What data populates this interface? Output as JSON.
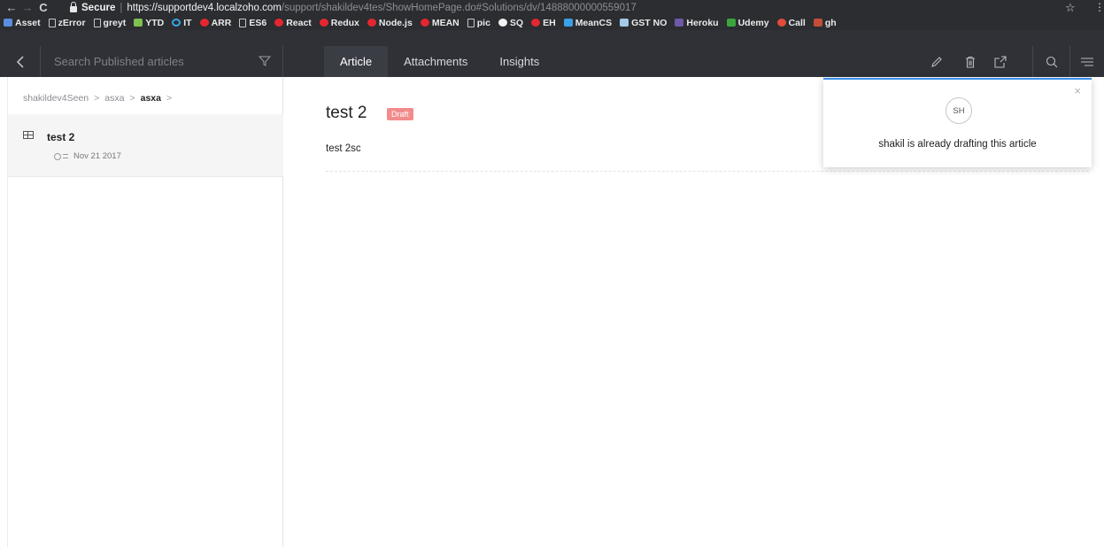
{
  "browser": {
    "back_glyph": "←",
    "forward_glyph": "→",
    "reload_glyph": "C",
    "secure_label": "Secure",
    "url_host": "https://supportdev4.localzoho.com",
    "url_path": "/support/shakildev4tes/ShowHomePage.do#Solutions/dv/14888000000559017",
    "star_glyph": "☆",
    "menu_glyph": "⋮",
    "bookmarks": [
      {
        "label": "Asset",
        "icon": "asset-icon"
      },
      {
        "label": "zError",
        "icon": "doc-icon"
      },
      {
        "label": "greyt",
        "icon": "doc-icon"
      },
      {
        "label": "YTD",
        "icon": "green-icon"
      },
      {
        "label": "IT",
        "icon": "ie-icon"
      },
      {
        "label": "ARR",
        "icon": "youtube-icon"
      },
      {
        "label": "ES6",
        "icon": "doc-icon"
      },
      {
        "label": "React",
        "icon": "youtube-icon"
      },
      {
        "label": "Redux",
        "icon": "youtube-icon"
      },
      {
        "label": "Node.js",
        "icon": "youtube-icon"
      },
      {
        "label": "MEAN",
        "icon": "youtube-icon"
      },
      {
        "label": "pic",
        "icon": "doc-icon"
      },
      {
        "label": "SQ",
        "icon": "github-icon"
      },
      {
        "label": "EH",
        "icon": "youtube-icon"
      },
      {
        "label": "MeanCS",
        "icon": "blue-icon"
      },
      {
        "label": "GST NO",
        "icon": "gst-icon"
      },
      {
        "label": "Heroku",
        "icon": "heroku-icon"
      },
      {
        "label": "Udemy",
        "icon": "udemy-icon"
      },
      {
        "label": "Call",
        "icon": "call-icon"
      },
      {
        "label": "gh",
        "icon": "pic-icon"
      }
    ]
  },
  "header": {
    "search_placeholder": "Search Published articles",
    "tabs": [
      {
        "label": "Article",
        "active": true
      },
      {
        "label": "Attachments",
        "active": false
      },
      {
        "label": "Insights",
        "active": false
      }
    ]
  },
  "sidebar": {
    "breadcrumb": [
      "shakildev4Seen",
      "asxa",
      "asxa"
    ],
    "chevron": ">",
    "article": {
      "title": "test 2",
      "date": "Nov 21 2017"
    }
  },
  "article": {
    "title": "test 2",
    "status": "Draft",
    "body": "test 2sc"
  },
  "popup": {
    "avatar_initials": "SH",
    "message": "shakil is already drafting this article",
    "close_glyph": "×"
  },
  "colors": {
    "header_bg": "#2f3137",
    "accent_blue": "#3a8ee6",
    "draft_badge": "#f28b8b"
  }
}
